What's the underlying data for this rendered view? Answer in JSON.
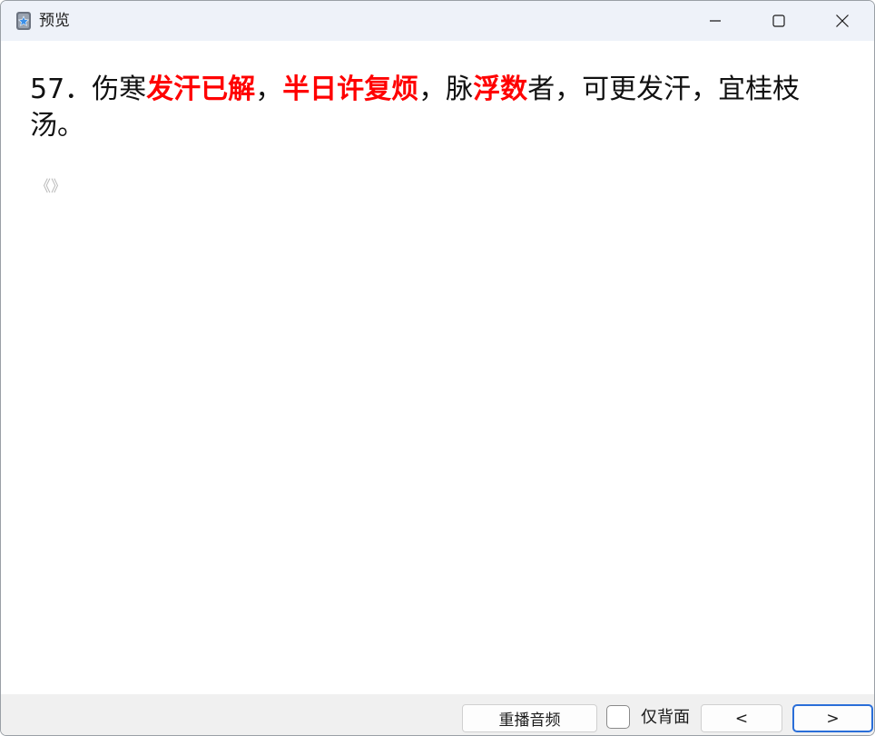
{
  "window": {
    "title": "预览",
    "app_icon": "anki-star-icon",
    "controls": {
      "minimize_icon": "minimize-icon",
      "maximize_icon": "maximize-icon",
      "close_icon": "close-icon"
    }
  },
  "card": {
    "segments": [
      {
        "text": "57．伤寒",
        "highlight": false
      },
      {
        "text": "发汗已解",
        "highlight": true
      },
      {
        "text": "，",
        "highlight": false
      },
      {
        "text": "半日许复烦",
        "highlight": true
      },
      {
        "text": "，脉",
        "highlight": false
      },
      {
        "text": "浮数",
        "highlight": true
      },
      {
        "text": "者，可更发汗，宜桂枝汤。",
        "highlight": false
      }
    ],
    "source_mark": "《》"
  },
  "bottom": {
    "replay_label": "重播音频",
    "back_only_label": "仅背面",
    "back_only_checked": false,
    "prev_label": "<",
    "next_label": ">"
  },
  "colors": {
    "highlight": "#ff0000",
    "titlebar": "#eef2f9",
    "focus_border": "#2a6ed8"
  }
}
